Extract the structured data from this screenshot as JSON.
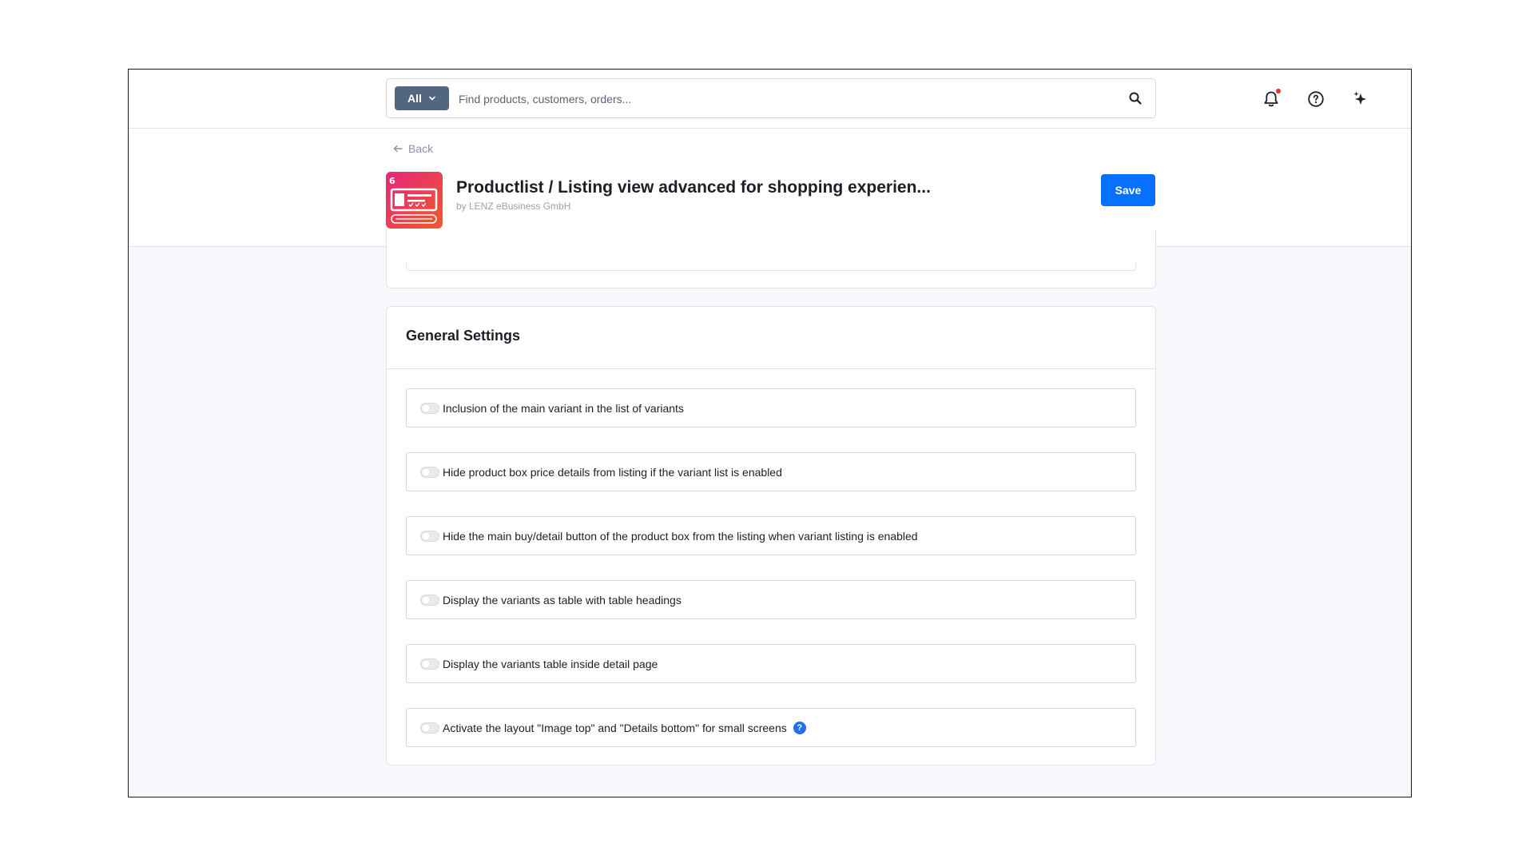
{
  "search": {
    "scope_label": "All",
    "placeholder": "Find products, customers, orders..."
  },
  "topbar": {
    "icons": [
      "bell-icon",
      "help-circle-icon",
      "sparkle-icon"
    ],
    "notification_dot_color": "#e5333a"
  },
  "header": {
    "back_label": "Back",
    "title": "Productlist / Listing view advanced for shopping experien...",
    "vendor": "by LENZ eBusiness GmbH",
    "save_label": "Save",
    "app_icon_badge": "6"
  },
  "general_settings": {
    "title": "General Settings",
    "items": [
      {
        "label": "Inclusion of the main variant in the list of variants",
        "enabled": false
      },
      {
        "label": "Hide product box price details from listing if the variant list is enabled",
        "enabled": false
      },
      {
        "label": "Hide the main buy/detail button of the product box from the listing when variant listing is enabled",
        "enabled": false
      },
      {
        "label": "Display the variants as table with table headings",
        "enabled": false
      },
      {
        "label": "Display the variants table inside detail page",
        "enabled": false
      },
      {
        "label": "Activate the layout \"Image top\" and \"Details bottom\" for small screens",
        "enabled": false,
        "has_info": true,
        "info_symbol": "?"
      }
    ]
  },
  "colors": {
    "accent": "#0870ff",
    "scope_button": "#526681",
    "info_icon": "#1f6ff2",
    "background": "#f8f9fc"
  }
}
